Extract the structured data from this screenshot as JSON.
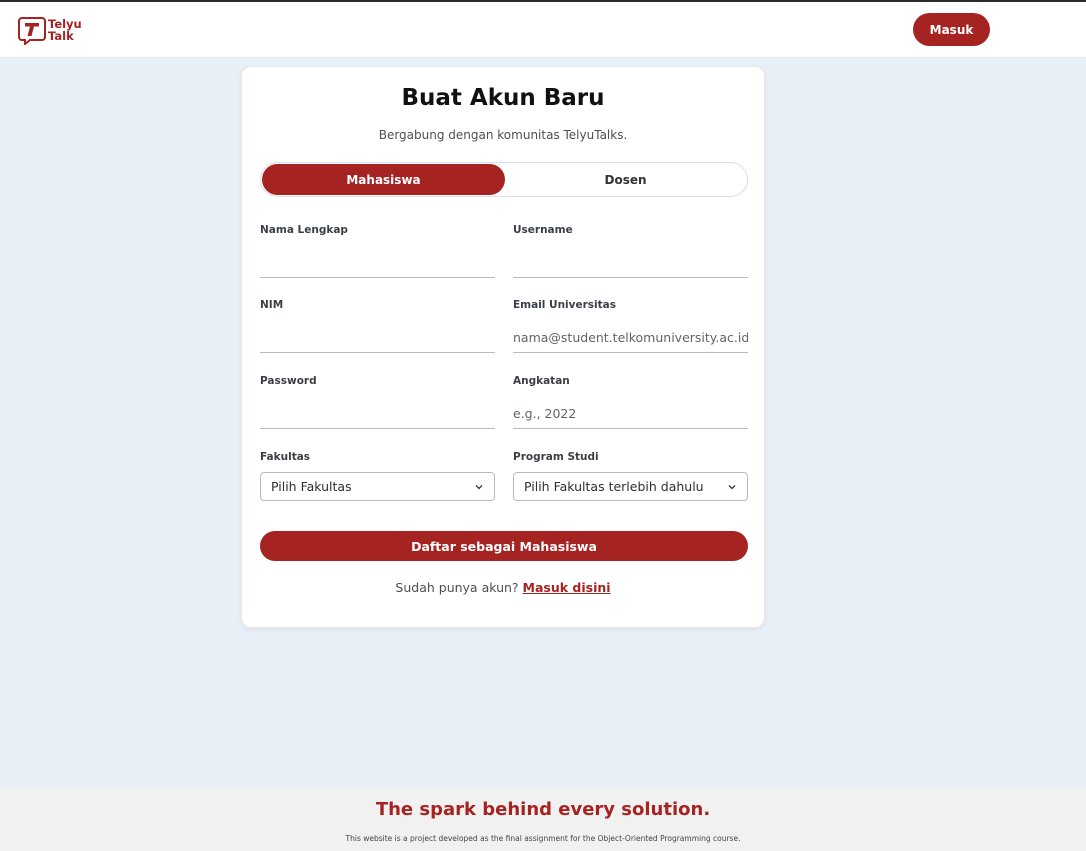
{
  "header": {
    "logo_line1": "Telyu",
    "logo_line2": "Talk",
    "login_label": "Masuk"
  },
  "form": {
    "title": "Buat Akun Baru",
    "subtitle": "Bergabung dengan komunitas TelyuTalks.",
    "roles": [
      {
        "label": "Mahasiswa",
        "active": true
      },
      {
        "label": "Dosen",
        "active": false
      }
    ],
    "fields": {
      "full_name": {
        "label": "Nama Lengkap",
        "placeholder": "",
        "value": ""
      },
      "username": {
        "label": "Username",
        "placeholder": "",
        "value": ""
      },
      "nim": {
        "label": "NIM",
        "placeholder": "",
        "value": ""
      },
      "email": {
        "label": "Email Universitas",
        "placeholder": "nama@student.telkomuniversity.ac.id",
        "value": ""
      },
      "password": {
        "label": "Password",
        "placeholder": "",
        "value": ""
      },
      "year": {
        "label": "Angkatan",
        "placeholder": "e.g., 2022",
        "value": ""
      },
      "faculty": {
        "label": "Fakultas",
        "selected": "Pilih Fakultas"
      },
      "program": {
        "label": "Program Studi",
        "selected": "Pilih Fakultas terlebih dahulu"
      }
    },
    "submit_label": "Daftar sebagai Mahasiswa",
    "login_prompt": "Sudah punya akun?",
    "login_link": "Masuk disini"
  },
  "footer": {
    "tagline": "The spark behind every solution.",
    "note": "This website is a project developed as the final assignment for the Object-Oriented Programming course."
  },
  "colors": {
    "brand": "#a52422",
    "background": "#e9eff6",
    "footer_bg": "#f1f1f1"
  }
}
